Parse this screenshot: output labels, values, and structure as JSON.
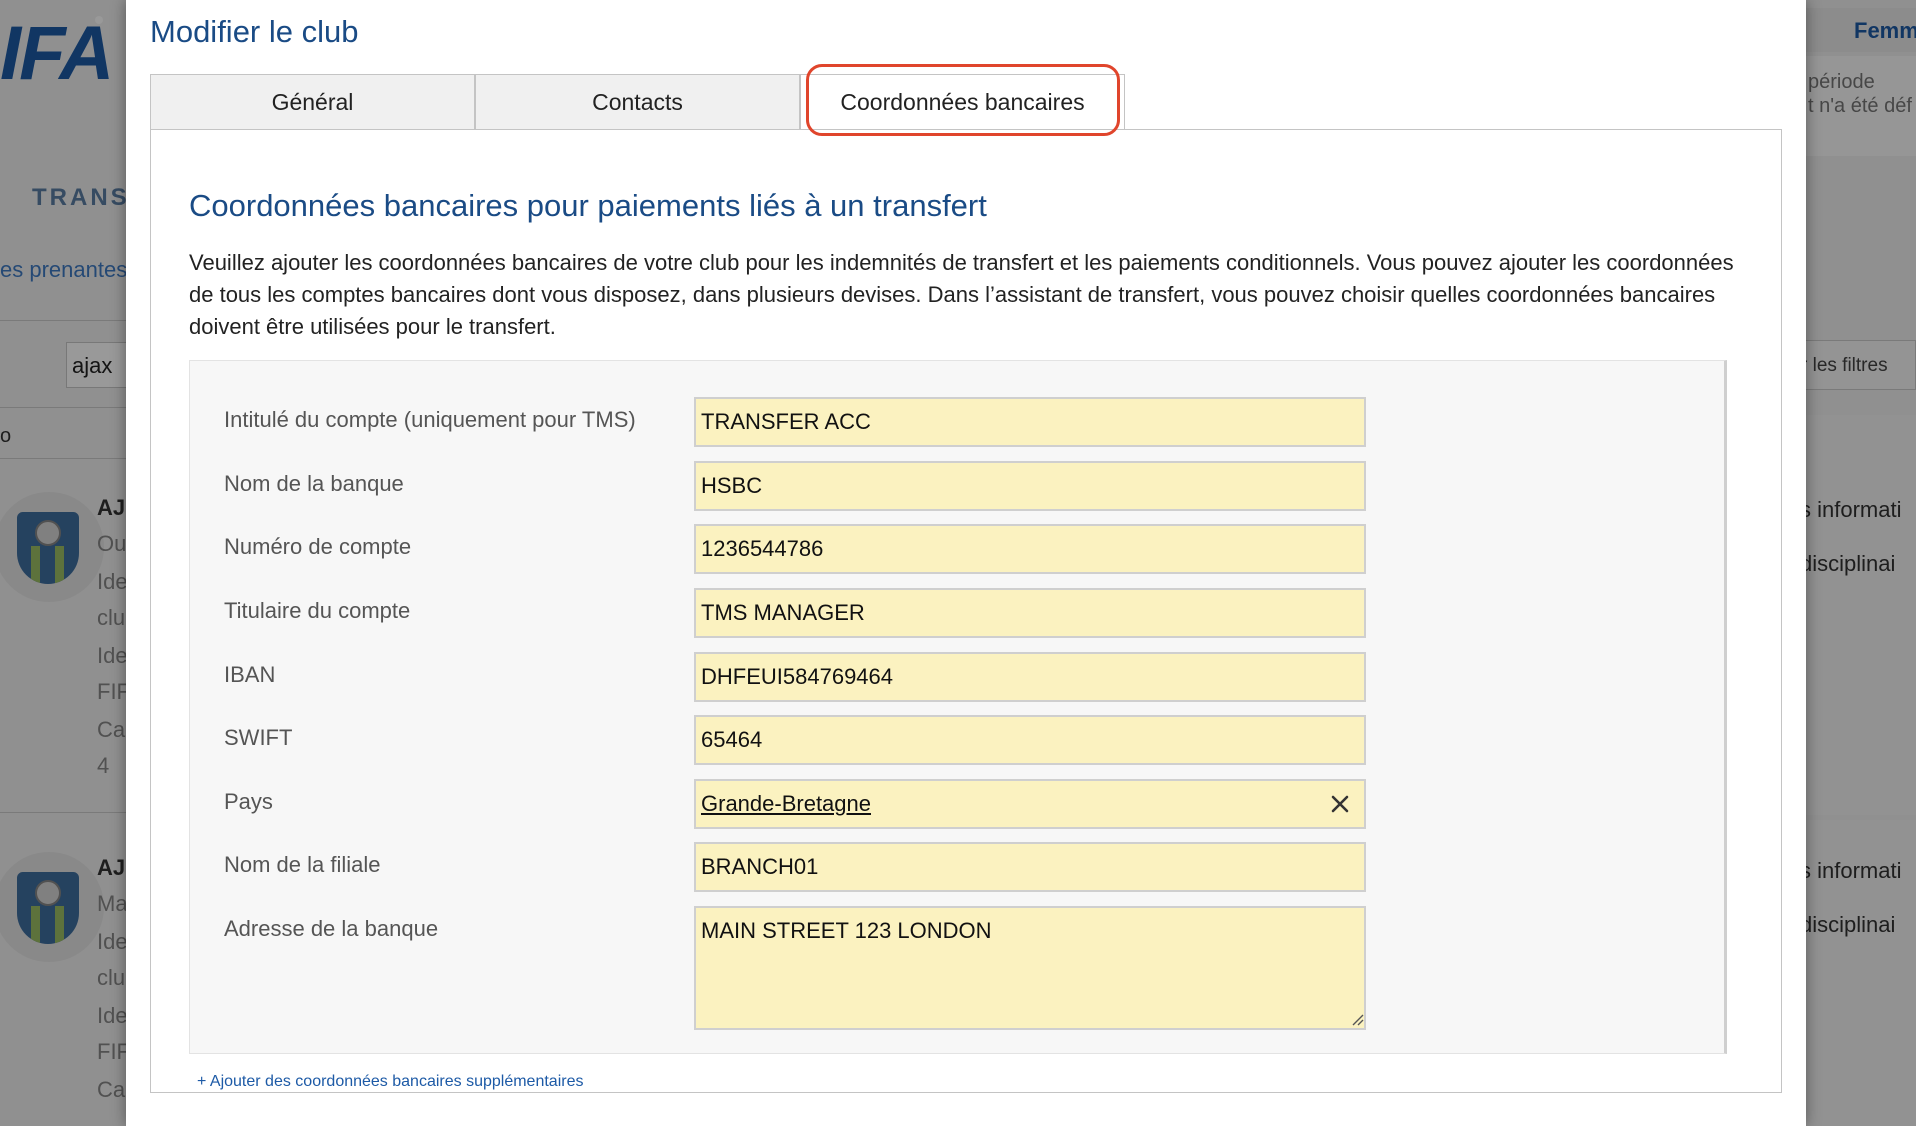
{
  "background": {
    "logo": "IFA",
    "section": "TRANS",
    "prenantes": "es prenantes",
    "search_value": "ajax",
    "p": "o",
    "club1": {
      "name": "AJ",
      "line1": "Ou",
      "line2": "Ide",
      "line3": "clu",
      "line4": "Ide",
      "line5": "FIF",
      "line6": "Ca",
      "line7": "4"
    },
    "club2": {
      "name": "AJ",
      "line1": "Ma",
      "line2": "Ide",
      "line3": "clu",
      "line4": "Ide",
      "line5": "FIF",
      "line6": "Ca"
    },
    "right_tab": "Femm",
    "right_periode_1": "période",
    "right_periode_2": "t n'a été déf",
    "right_filtres": "r les filtres",
    "right_info_1": "s informati",
    "right_disc_1": "disciplinai",
    "right_info_2": "s informati",
    "right_disc_2": "disciplinai"
  },
  "modal": {
    "title": "Modifier le club",
    "tabs": [
      {
        "label": "Général",
        "active": false
      },
      {
        "label": "Contacts",
        "active": false
      },
      {
        "label": "Coordonnées bancaires",
        "active": true
      }
    ],
    "section_title": "Coordonnées bancaires pour paiements liés à un transfert",
    "section_description": "Veuillez ajouter les coordonnées bancaires de votre club pour les indemnités de transfert et les paiements conditionnels. Vous pouvez ajouter les coordonnées de tous les comptes bancaires dont vous disposez, dans plusieurs devises. Dans l’assistant de transfert, vous pouvez choisir quelles coordonnées bancaires doivent être utilisées pour le transfert.",
    "fields": {
      "account_title": {
        "label": "Intitulé du compte (uniquement pour TMS)",
        "value": "TRANSFER ACC"
      },
      "bank_name": {
        "label": "Nom de la banque",
        "value": "HSBC"
      },
      "account_number": {
        "label": "Numéro de compte",
        "value": "1236544786"
      },
      "account_holder": {
        "label": "Titulaire du compte",
        "value": "TMS MANAGER"
      },
      "iban": {
        "label": "IBAN",
        "value": "DHFEUI584769464"
      },
      "swift": {
        "label": "SWIFT",
        "value": "65464"
      },
      "country": {
        "label": "Pays",
        "value": "Grande-Bretagne"
      },
      "branch_name": {
        "label": "Nom de la filiale",
        "value": "BRANCH01"
      },
      "bank_address": {
        "label": "Adresse de la banque",
        "value": "MAIN STREET 123 LONDON"
      }
    },
    "add_link": "+ Ajouter des coordonnées bancaires supplémentaires"
  },
  "colors": {
    "accent": "#1a4b85",
    "input_fill": "#fbf2c0",
    "tab_highlight": "#e0452c"
  }
}
